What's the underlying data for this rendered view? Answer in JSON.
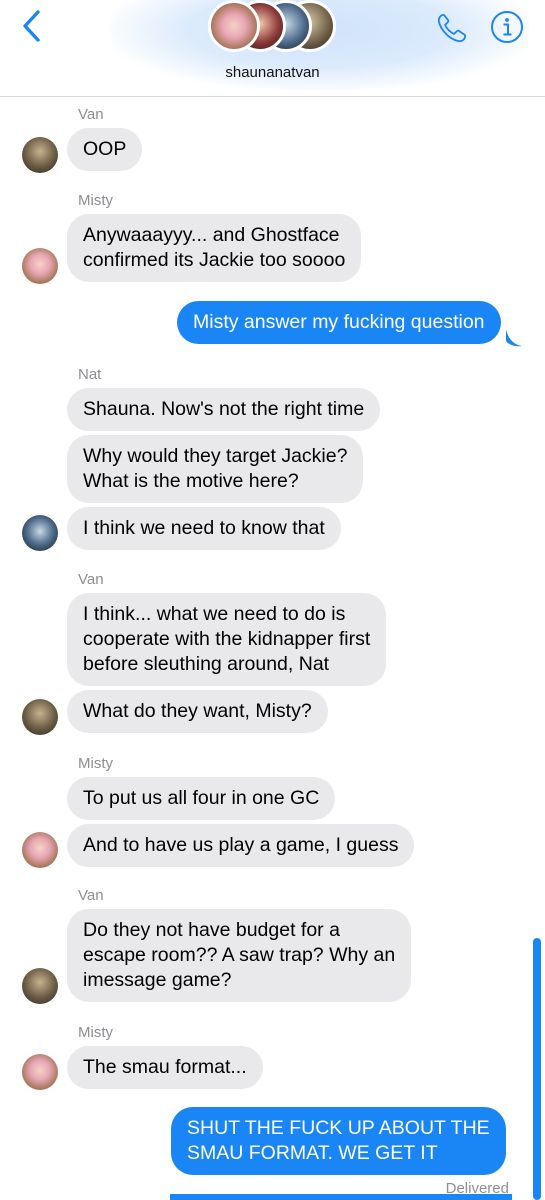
{
  "header": {
    "group_name": "shaunanatvan"
  },
  "messages": [
    {
      "sender": "Van",
      "text": "OOP"
    },
    {
      "sender": "Misty",
      "lines": [
        "Anywaaayyy... and Ghostface",
        "confirmed its Jackie too soooo"
      ]
    },
    {
      "outgoing": true,
      "text": "Misty answer my fucking question"
    },
    {
      "sender": "Nat",
      "text": "Shauna. Now's not the right time"
    },
    {
      "lines": [
        "Why would they target Jackie?",
        "What is the motive here?"
      ]
    },
    {
      "text": "I think we need to know that"
    },
    {
      "sender": "Van",
      "lines": [
        "I think... what we need to do is",
        "cooperate with the kidnapper first",
        "before sleuthing around, Nat"
      ]
    },
    {
      "text": "What do they want, Misty?"
    },
    {
      "sender": "Misty",
      "text": "To put us all four in one GC"
    },
    {
      "text": "And to have us play a game, I guess"
    },
    {
      "sender": "Van",
      "lines": [
        "Do they not have budget for a",
        "escape room?? A saw trap? Why an",
        "imessage game?"
      ]
    },
    {
      "sender": "Misty",
      "text": "The smau format..."
    },
    {
      "outgoing": true,
      "lines": [
        "SHUT THE FUCK UP ABOUT THE",
        "SMAU FORMAT. WE GET IT"
      ]
    }
  ],
  "status": {
    "delivered": "Delivered"
  },
  "colors": {
    "outgoing_bubble": "#1a86f5",
    "incoming_bubble": "#e9e9eb",
    "accent": "#1a86f5"
  }
}
